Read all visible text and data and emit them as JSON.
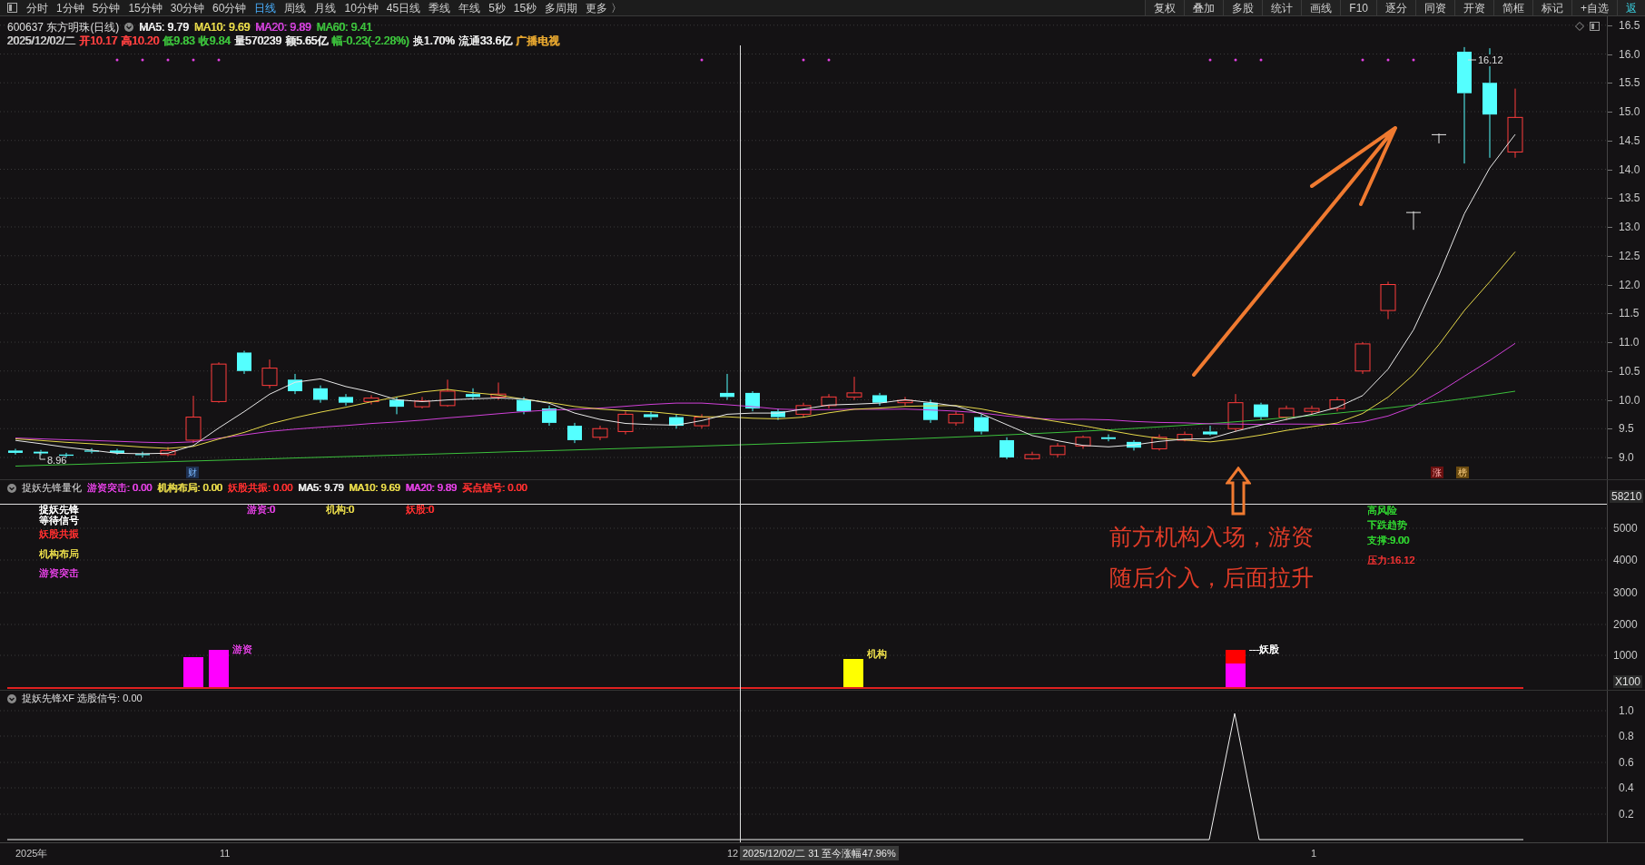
{
  "toolbar": {
    "periods": [
      {
        "label": "分时",
        "selected": false
      },
      {
        "label": "1分钟",
        "selected": false
      },
      {
        "label": "5分钟",
        "selected": false
      },
      {
        "label": "15分钟",
        "selected": false
      },
      {
        "label": "30分钟",
        "selected": false
      },
      {
        "label": "60分钟",
        "selected": false
      },
      {
        "label": "日线",
        "selected": true
      },
      {
        "label": "周线",
        "selected": false
      },
      {
        "label": "月线",
        "selected": false
      },
      {
        "label": "10分钟",
        "selected": false
      },
      {
        "label": "45日线",
        "selected": false
      },
      {
        "label": "季线",
        "selected": false
      },
      {
        "label": "年线",
        "selected": false
      },
      {
        "label": "5秒",
        "selected": false
      },
      {
        "label": "15秒",
        "selected": false
      },
      {
        "label": "多周期",
        "selected": false
      },
      {
        "label": "更多 〉",
        "selected": false
      }
    ],
    "tools": [
      "复权",
      "叠加",
      "多股",
      "统计",
      "画线",
      "F10",
      "逐分",
      "同资",
      "开资",
      "简框",
      "标记",
      "+自选",
      "返"
    ]
  },
  "header": {
    "title": "600637 东方明珠(日线)",
    "ma": [
      {
        "label": "MA5: 9.79",
        "color": "#e8e8e8"
      },
      {
        "label": "MA10: 9.69",
        "color": "#e6d84a"
      },
      {
        "label": "MA20: 9.89",
        "color": "#d040d8"
      },
      {
        "label": "MA60: 9.41",
        "color": "#3cc03c"
      }
    ],
    "quote": [
      {
        "label": "2025/12/02/二",
        "color": "#c8c8c8"
      },
      {
        "label": "开10.17",
        "color": "#ff4040"
      },
      {
        "label": "高10.20",
        "color": "#ff4040"
      },
      {
        "label": "低9.83",
        "color": "#3cc03c"
      },
      {
        "label": "收9.84",
        "color": "#3cc03c"
      },
      {
        "label": "量570239",
        "color": "#e8e8e8"
      },
      {
        "label": "额5.65亿",
        "color": "#e8e8e8"
      },
      {
        "label": "幅-0.23(-2.28%)",
        "color": "#3cc03c"
      },
      {
        "label": "换1.70%",
        "color": "#e8e8e8"
      },
      {
        "label": "流通33.6亿",
        "color": "#e8e8e8"
      },
      {
        "label": "广播电视",
        "color": "#e8a830"
      }
    ]
  },
  "main_chart": {
    "price_axis": [
      "16.5",
      "16.0",
      "15.5",
      "15.0",
      "14.5",
      "14.0",
      "13.5",
      "13.0",
      "12.5",
      "12.0",
      "11.5",
      "11.0",
      "10.5",
      "10.0",
      "9.5",
      "9.0"
    ],
    "high_label": "16.12",
    "low_label": "8.96",
    "badges": [
      {
        "label": "财",
        "kind": "finance"
      },
      {
        "label": "涨",
        "kind": "up"
      },
      {
        "label": "榜",
        "kind": "rank"
      }
    ],
    "annotation": [
      "前方机构入场，游资",
      "随后介入，后面拉升"
    ]
  },
  "panel_2": {
    "title": "捉妖先锋量化",
    "values": [
      {
        "label": "游资突击: 0.00",
        "color": "#e040e0"
      },
      {
        "label": "机构布局: 0.00",
        "color": "#e6d84a"
      },
      {
        "label": "妖股共振: 0.00",
        "color": "#ff3030"
      },
      {
        "label": "MA5: 9.79",
        "color": "#e8e8e8"
      },
      {
        "label": "MA10: 9.69",
        "color": "#e6d84a"
      },
      {
        "label": "MA20: 9.89",
        "color": "#e040e0"
      },
      {
        "label": "买点信号: 0.00",
        "color": "#ff3030"
      }
    ],
    "legend": [
      {
        "label": "捉妖先锋",
        "color": "#ffffff"
      },
      {
        "label": "等待信号",
        "color": "#ffffff"
      },
      {
        "label": "妖股共振",
        "color": "#ff3030"
      },
      {
        "label": "机构布局",
        "color": "#e6d84a"
      },
      {
        "label": "游资突击",
        "color": "#e040e0"
      }
    ],
    "counters": [
      {
        "label": "游资:0",
        "color": "#e040e0"
      },
      {
        "label": "机构:0",
        "color": "#e6d84a"
      },
      {
        "label": "妖股:0",
        "color": "#ff3030"
      }
    ],
    "bar_labels": [
      {
        "label": "游资",
        "color": "#e040e0"
      },
      {
        "label": "机构",
        "color": "#e6d84a"
      },
      {
        "label": "---妖股",
        "color": "#ffffff"
      }
    ],
    "signals": [
      {
        "label": "高风险",
        "color": "#30d030"
      },
      {
        "label": "下跌趋势",
        "color": "#30d030"
      },
      {
        "label": "支撑:9.00",
        "color": "#30d030"
      },
      {
        "label": "压力:16.12",
        "color": "#e03030"
      }
    ],
    "axis": [
      "58210",
      "5000",
      "4000",
      "3000",
      "2000",
      "1000",
      "X100"
    ]
  },
  "panel_3": {
    "title": "捉妖先锋XF 选股信号: 0.00",
    "axis": [
      "1.0",
      "0.8",
      "0.6",
      "0.4",
      "0.2"
    ]
  },
  "time_axis": {
    "labels": [
      "2025年",
      "11",
      "12",
      "1"
    ],
    "cursor_label": "2025/12/02/二 31 至今涨幅47.96%"
  }
}
